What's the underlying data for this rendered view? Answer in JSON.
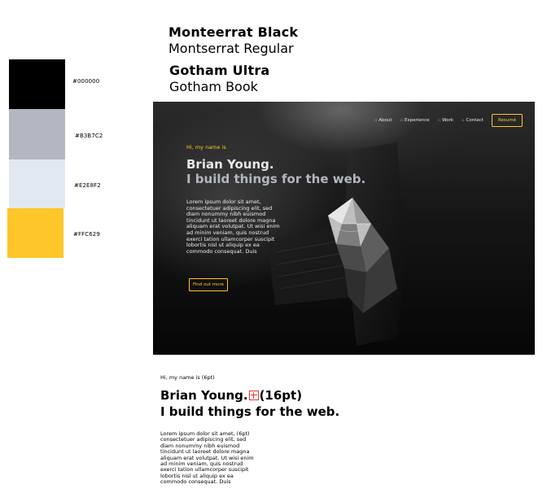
{
  "fonts": {
    "line1": "Monteerrat Black",
    "line2": "Montserrat Regular",
    "line3": "Gotham Ultra",
    "line4": "Gotham Book"
  },
  "palette": [
    {
      "hex": "#000000",
      "label": "#000000"
    },
    {
      "hex": "#B3B7C2",
      "label": "#B3B7C2"
    },
    {
      "hex": "#E2E8F2",
      "label": "#E2E8F2"
    },
    {
      "hex": "#FFC629",
      "label": "#FFC629"
    }
  ],
  "hero": {
    "nav": {
      "about": ":: About",
      "experience": ":: Experience",
      "work": ":: Work",
      "contact": ":: Contact",
      "resume": "Resumé"
    },
    "greeting": "Hi, my name is",
    "name": "Brian Young.",
    "tagline": "I build things for the web.",
    "body": "Lorem ipsum dolor sit amet, consectetuer adipiscing elit, sed diam nonummy nibh euismod tincidunt ut laoreet dolore magna aliquam erat volutpat. Ut wisi enim ad minim veniam, quis nostrud exerci tation ullamcorper suscipit lobortis nisl ut aliquip ex ea commodo consequat. Duis",
    "cta": "Find out more"
  },
  "spec": {
    "greeting": "Hi, my name is (6pt)",
    "name": "Brian Young.",
    "name_size": "(16pt)",
    "tagline": "I build things for the web.",
    "body": "Lorem ipsum dolor sit amet, (6pt) consectetuer adipiscing elit, sed diam nonummy nibh euismod tincidunt ut laoreet dolore magna aliquam erat volutpat. Ut wisi enim ad minim veniam, quis nostrud exerci tation ullamcorper suscipit lobortis nisl ut aliquip ex ea commodo consequat. Duis"
  }
}
